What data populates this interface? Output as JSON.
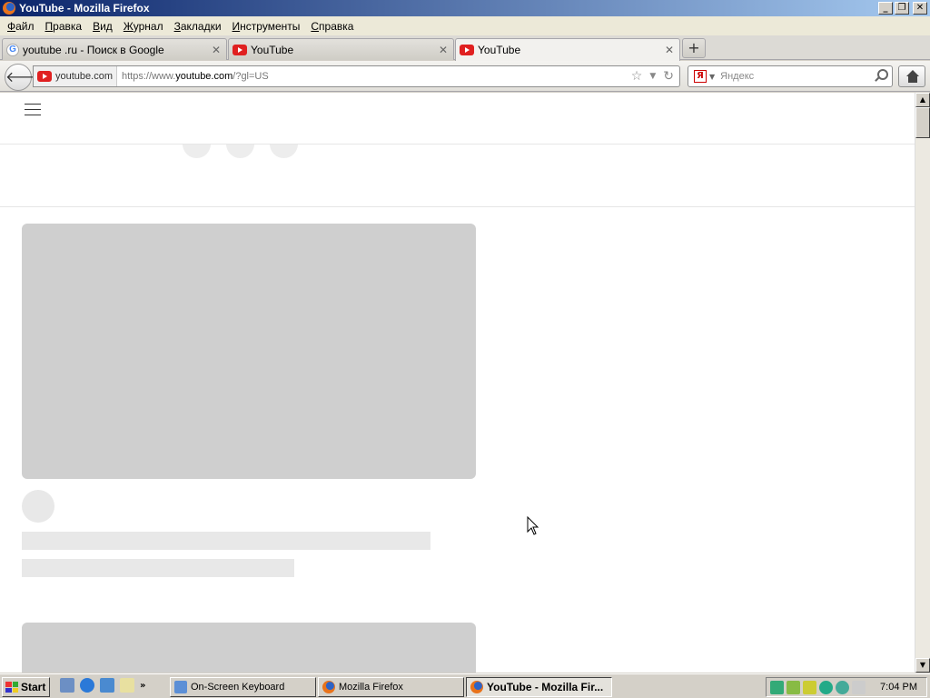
{
  "window": {
    "title": "YouTube - Mozilla Firefox"
  },
  "menu": {
    "items": [
      "Файл",
      "Правка",
      "Вид",
      "Журнал",
      "Закладки",
      "Инструменты",
      "Справка"
    ]
  },
  "tabs": [
    {
      "label": "youtube .ru - Поиск в Google",
      "favicon": "google-icon",
      "active": false
    },
    {
      "label": "YouTube",
      "favicon": "youtube-icon",
      "active": false
    },
    {
      "label": "YouTube",
      "favicon": "youtube-icon",
      "active": true
    }
  ],
  "nav": {
    "identity_label": "youtube.com",
    "url_prefix": "https://www.",
    "url_host": "youtube.com",
    "url_suffix": "/?gl=US",
    "search_placeholder": "Яндекс",
    "search_engine_letter": "Я"
  },
  "taskbar": {
    "start_label": "Start",
    "tasks": [
      {
        "label": "On-Screen Keyboard",
        "active": false
      },
      {
        "label": "Mozilla Firefox",
        "active": false
      },
      {
        "label": "YouTube - Mozilla Fir...",
        "active": true
      }
    ],
    "clock": "7:04 PM",
    "more_glyph": "»"
  },
  "colors": {
    "skeleton_thumb": "#cfcfcf",
    "skeleton_line": "#e8e8e8",
    "youtube_red": "#e02020"
  }
}
